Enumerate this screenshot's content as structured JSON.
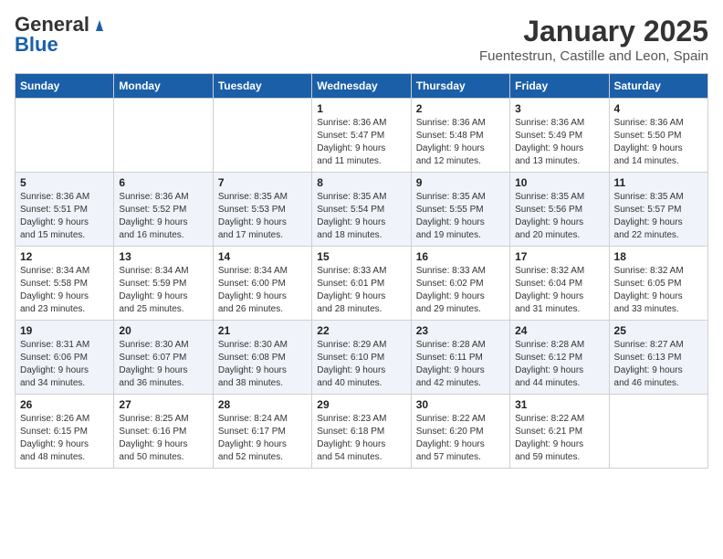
{
  "header": {
    "logo_general": "General",
    "logo_blue": "Blue",
    "month": "January 2025",
    "location": "Fuentestrun, Castille and Leon, Spain"
  },
  "days_of_week": [
    "Sunday",
    "Monday",
    "Tuesday",
    "Wednesday",
    "Thursday",
    "Friday",
    "Saturday"
  ],
  "weeks": [
    [
      {
        "day": "",
        "info": ""
      },
      {
        "day": "",
        "info": ""
      },
      {
        "day": "",
        "info": ""
      },
      {
        "day": "1",
        "info": "Sunrise: 8:36 AM\nSunset: 5:47 PM\nDaylight: 9 hours\nand 11 minutes."
      },
      {
        "day": "2",
        "info": "Sunrise: 8:36 AM\nSunset: 5:48 PM\nDaylight: 9 hours\nand 12 minutes."
      },
      {
        "day": "3",
        "info": "Sunrise: 8:36 AM\nSunset: 5:49 PM\nDaylight: 9 hours\nand 13 minutes."
      },
      {
        "day": "4",
        "info": "Sunrise: 8:36 AM\nSunset: 5:50 PM\nDaylight: 9 hours\nand 14 minutes."
      }
    ],
    [
      {
        "day": "5",
        "info": "Sunrise: 8:36 AM\nSunset: 5:51 PM\nDaylight: 9 hours\nand 15 minutes."
      },
      {
        "day": "6",
        "info": "Sunrise: 8:36 AM\nSunset: 5:52 PM\nDaylight: 9 hours\nand 16 minutes."
      },
      {
        "day": "7",
        "info": "Sunrise: 8:35 AM\nSunset: 5:53 PM\nDaylight: 9 hours\nand 17 minutes."
      },
      {
        "day": "8",
        "info": "Sunrise: 8:35 AM\nSunset: 5:54 PM\nDaylight: 9 hours\nand 18 minutes."
      },
      {
        "day": "9",
        "info": "Sunrise: 8:35 AM\nSunset: 5:55 PM\nDaylight: 9 hours\nand 19 minutes."
      },
      {
        "day": "10",
        "info": "Sunrise: 8:35 AM\nSunset: 5:56 PM\nDaylight: 9 hours\nand 20 minutes."
      },
      {
        "day": "11",
        "info": "Sunrise: 8:35 AM\nSunset: 5:57 PM\nDaylight: 9 hours\nand 22 minutes."
      }
    ],
    [
      {
        "day": "12",
        "info": "Sunrise: 8:34 AM\nSunset: 5:58 PM\nDaylight: 9 hours\nand 23 minutes."
      },
      {
        "day": "13",
        "info": "Sunrise: 8:34 AM\nSunset: 5:59 PM\nDaylight: 9 hours\nand 25 minutes."
      },
      {
        "day": "14",
        "info": "Sunrise: 8:34 AM\nSunset: 6:00 PM\nDaylight: 9 hours\nand 26 minutes."
      },
      {
        "day": "15",
        "info": "Sunrise: 8:33 AM\nSunset: 6:01 PM\nDaylight: 9 hours\nand 28 minutes."
      },
      {
        "day": "16",
        "info": "Sunrise: 8:33 AM\nSunset: 6:02 PM\nDaylight: 9 hours\nand 29 minutes."
      },
      {
        "day": "17",
        "info": "Sunrise: 8:32 AM\nSunset: 6:04 PM\nDaylight: 9 hours\nand 31 minutes."
      },
      {
        "day": "18",
        "info": "Sunrise: 8:32 AM\nSunset: 6:05 PM\nDaylight: 9 hours\nand 33 minutes."
      }
    ],
    [
      {
        "day": "19",
        "info": "Sunrise: 8:31 AM\nSunset: 6:06 PM\nDaylight: 9 hours\nand 34 minutes."
      },
      {
        "day": "20",
        "info": "Sunrise: 8:30 AM\nSunset: 6:07 PM\nDaylight: 9 hours\nand 36 minutes."
      },
      {
        "day": "21",
        "info": "Sunrise: 8:30 AM\nSunset: 6:08 PM\nDaylight: 9 hours\nand 38 minutes."
      },
      {
        "day": "22",
        "info": "Sunrise: 8:29 AM\nSunset: 6:10 PM\nDaylight: 9 hours\nand 40 minutes."
      },
      {
        "day": "23",
        "info": "Sunrise: 8:28 AM\nSunset: 6:11 PM\nDaylight: 9 hours\nand 42 minutes."
      },
      {
        "day": "24",
        "info": "Sunrise: 8:28 AM\nSunset: 6:12 PM\nDaylight: 9 hours\nand 44 minutes."
      },
      {
        "day": "25",
        "info": "Sunrise: 8:27 AM\nSunset: 6:13 PM\nDaylight: 9 hours\nand 46 minutes."
      }
    ],
    [
      {
        "day": "26",
        "info": "Sunrise: 8:26 AM\nSunset: 6:15 PM\nDaylight: 9 hours\nand 48 minutes."
      },
      {
        "day": "27",
        "info": "Sunrise: 8:25 AM\nSunset: 6:16 PM\nDaylight: 9 hours\nand 50 minutes."
      },
      {
        "day": "28",
        "info": "Sunrise: 8:24 AM\nSunset: 6:17 PM\nDaylight: 9 hours\nand 52 minutes."
      },
      {
        "day": "29",
        "info": "Sunrise: 8:23 AM\nSunset: 6:18 PM\nDaylight: 9 hours\nand 54 minutes."
      },
      {
        "day": "30",
        "info": "Sunrise: 8:22 AM\nSunset: 6:20 PM\nDaylight: 9 hours\nand 57 minutes."
      },
      {
        "day": "31",
        "info": "Sunrise: 8:22 AM\nSunset: 6:21 PM\nDaylight: 9 hours\nand 59 minutes."
      },
      {
        "day": "",
        "info": ""
      }
    ]
  ]
}
